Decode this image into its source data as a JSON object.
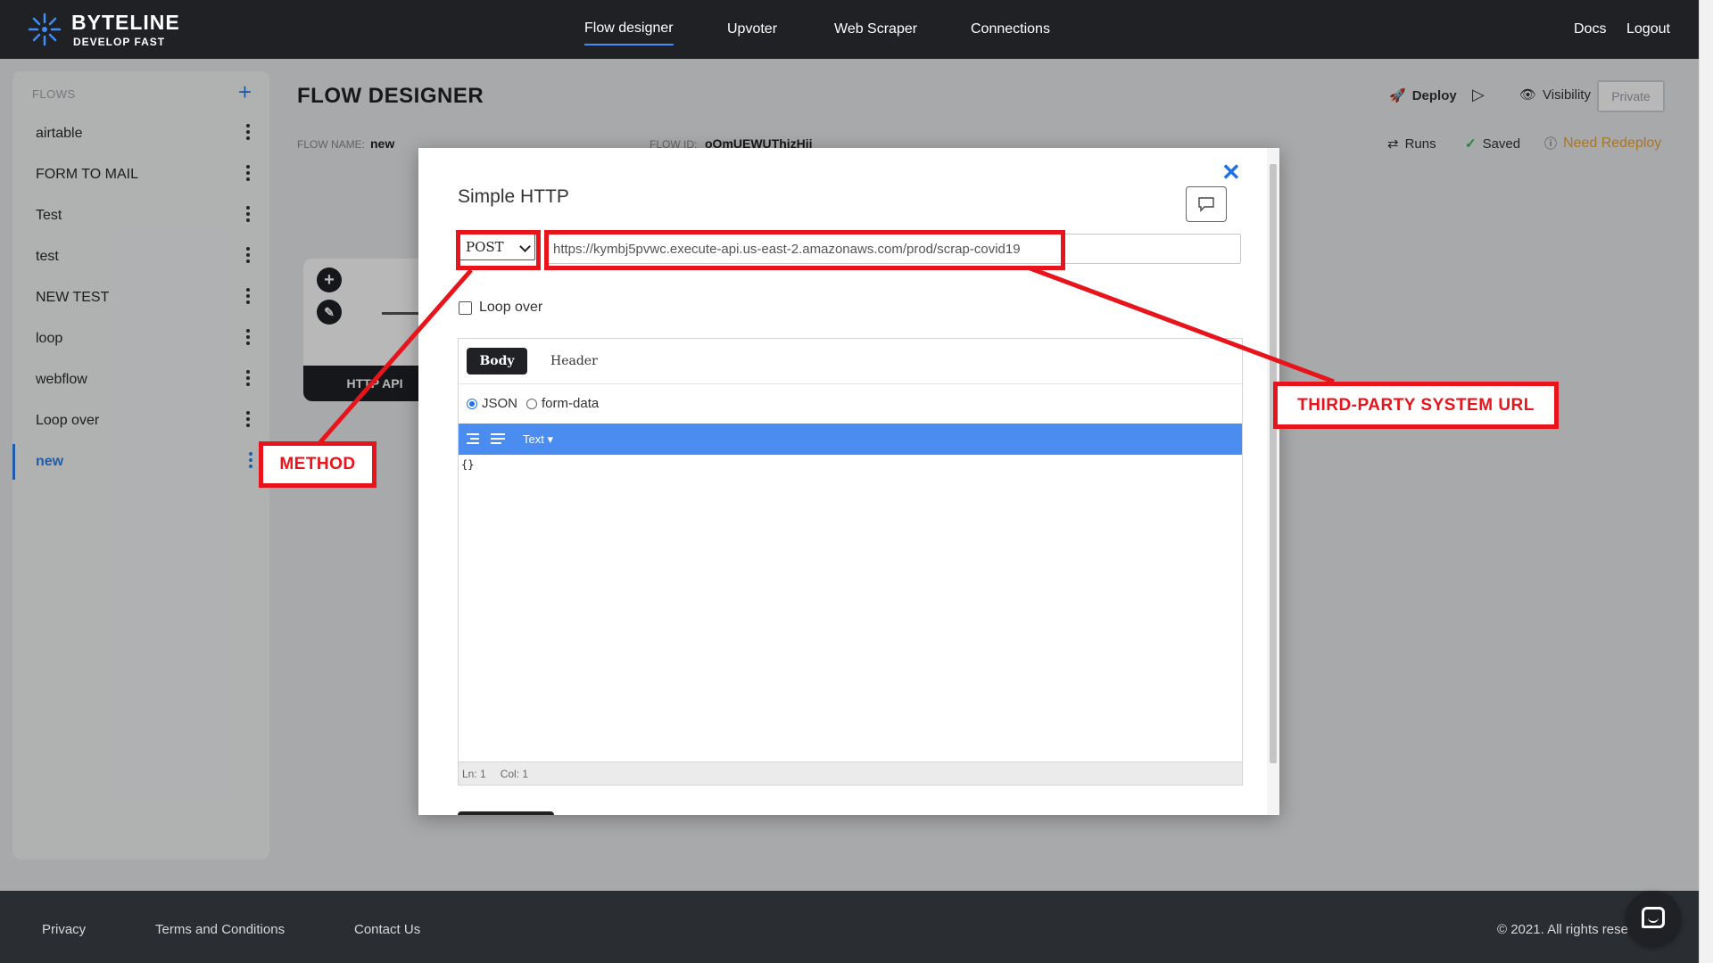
{
  "brand": {
    "name": "BYTELINE",
    "tagline": "DEVELOP FAST"
  },
  "nav": {
    "items": [
      "Flow designer",
      "Upvoter",
      "Web Scraper",
      "Connections"
    ],
    "active": "Flow designer",
    "docs": "Docs",
    "logout": "Logout"
  },
  "sidebar": {
    "header": "FLOWS",
    "add_icon": "plus-icon",
    "items": [
      "airtable",
      "FORM TO MAIL",
      "Test",
      "test",
      "NEW TEST",
      "loop",
      "webflow",
      "Loop over",
      "new"
    ],
    "active": "new"
  },
  "main": {
    "title": "FLOW DESIGNER",
    "flow_name_label": "FLOW NAME:",
    "flow_name": "new",
    "flow_id_label": "FLOW ID:",
    "flow_id": "oOmUEWUThizHij",
    "deploy": "Deploy",
    "visibility": "Visibility",
    "private": "Private",
    "runs": "Runs",
    "saved": "Saved",
    "need_redeploy": "Need Redeploy",
    "node_label": "HTTP API"
  },
  "modal": {
    "title": "Simple HTTP",
    "method": "POST",
    "url": "https://kymbj5pvwc.execute-api.us-east-2.amazonaws.com/prod/scrap-covid19",
    "loop_over": "Loop over",
    "tabs": [
      "Body",
      "Header"
    ],
    "active_tab": "Body",
    "body_types": [
      "JSON",
      "form-data"
    ],
    "selected_body_type": "JSON",
    "editor_mode": "Text",
    "editor_content": "{}",
    "status_ln": "Ln: 1",
    "status_col": "Col: 1"
  },
  "annotations": {
    "method": "METHOD",
    "url": "THIRD-PARTY SYSTEM URL"
  },
  "footer": {
    "links": [
      "Privacy",
      "Terms and Conditions",
      "Contact Us"
    ],
    "copyright": "© 2021. All rights rese"
  },
  "colors": {
    "accent": "#2f80ed",
    "annotation_red": "#e8141c",
    "topbar": "#1f2125",
    "editor_toolbar": "#4a8cf0",
    "saved_green": "#2db84d",
    "redeploy_orange": "#e8a43b"
  }
}
